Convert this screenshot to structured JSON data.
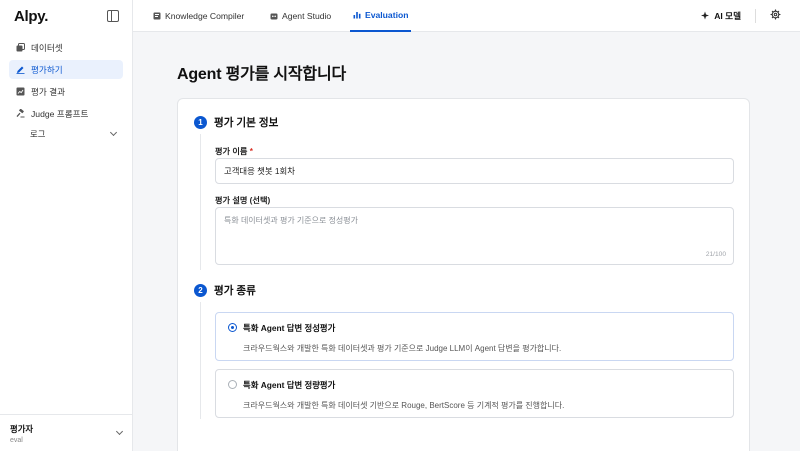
{
  "app": {
    "logo": "Alpy."
  },
  "sidebar": {
    "items": [
      {
        "label": "데이터셋",
        "icon": "dataset-icon"
      },
      {
        "label": "평가하기",
        "icon": "pencil-icon",
        "active": true
      },
      {
        "label": "평가 결과",
        "icon": "chart-icon"
      },
      {
        "label": "Judge 프롬프트",
        "icon": "gavel-icon"
      }
    ],
    "sub_item": {
      "label": "로그"
    },
    "user": {
      "name": "평가자",
      "role": "eval"
    }
  },
  "topbar": {
    "tabs": [
      {
        "label": "Knowledge Compiler",
        "icon": "book-icon"
      },
      {
        "label": "Agent Studio",
        "icon": "bot-icon"
      },
      {
        "label": "Evaluation",
        "icon": "bar-chart-icon",
        "active": true
      }
    ],
    "ai_model_label": "AI 모델"
  },
  "page": {
    "title": "Agent 평가를 시작합니다"
  },
  "section1": {
    "number": "1",
    "title": "평가 기본 정보",
    "name_label": "평가 이름",
    "required_mark": "*",
    "name_value": "고객대응 챗봇 1회차",
    "desc_label": "평가 설명 (선택)",
    "desc_placeholder": "특화 데이터셋과 평가 기준으로 정성평가",
    "desc_counter": "21/100"
  },
  "section2": {
    "number": "2",
    "title": "평가 종류",
    "options": [
      {
        "title": "특화 Agent 답변 정성평가",
        "desc": "크라우드웍스와 개발한 특화 데이터셋과 평가 기준으로 Judge LLM이 Agent 답변을 평가합니다.",
        "selected": true
      },
      {
        "title": "특화 Agent 답변 정량평가",
        "desc": "크라우드웍스와 개발한 특화 데이터셋 기반으로 Rouge, BertScore 등 기계적 평가를 진행합니다.",
        "selected": false
      }
    ]
  },
  "colors": {
    "accent": "#0b57d0",
    "required": "#d93025"
  }
}
